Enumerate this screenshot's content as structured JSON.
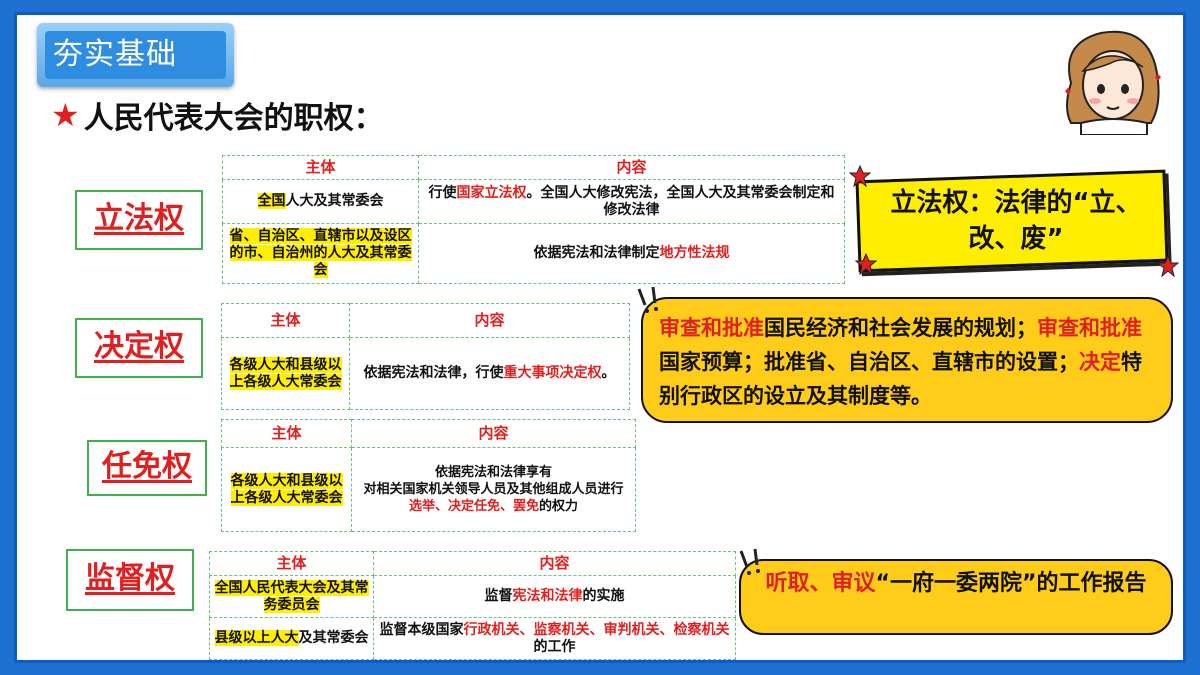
{
  "section_tag": "夯实基础",
  "headline": {
    "star": "★",
    "text": "人民代表大会的职权："
  },
  "colors": {
    "frame": "#0d5bc4",
    "accent_red": "#e0201f",
    "highlight": "#ffee00",
    "callout": "#ffcc1a",
    "border_green": "#3fb24f"
  },
  "powers": {
    "legislative": {
      "label": "立法权",
      "header_subject": "主体",
      "header_content": "内容",
      "rows": [
        {
          "subject_hl": "全国",
          "subject_rest": "人大及其常委会",
          "content_pre": "行使",
          "content_red": "国家立法权",
          "content_post": "。全国人大修改宪法，全国人大及其常委会制定和修改法律"
        },
        {
          "subject_hl": "省、自治区、直辖市以及设区的市、自治州的人大及其常委会",
          "subject_rest": "",
          "content_pre": "依据宪法和法律制定",
          "content_red": "地方性法规",
          "content_post": ""
        }
      ]
    },
    "decision": {
      "label": "决定权",
      "header_subject": "主体",
      "header_content": "内容",
      "subject": "各级人大和县级以上各级人大常委会",
      "content_pre": "依据宪法和法律，行使",
      "content_red": "重大事项决定权",
      "content_post": "。"
    },
    "appointment": {
      "label": "任免权",
      "header_subject": "主体",
      "header_content": "内容",
      "subject": "各级人大和县级以上各级人大常委会",
      "content_line1": "依据宪法和法律享有",
      "content_line2": "对相关国家机关领导人员及其他组成人员进行",
      "content_red": "选举、决定任免、罢免",
      "content_post": "的权力"
    },
    "supervision": {
      "label": "监督权",
      "header_subject": "主体",
      "header_content": "内容",
      "rows": [
        {
          "subject": "全国人民代表大会及其常务委员会",
          "content_pre": "监督",
          "content_red": "宪法和法律",
          "content_post": "的实施",
          "content_red2": "",
          "content_post2": ""
        },
        {
          "subject_hl": "县级以上人大",
          "subject_rest": "及其常委会",
          "content_pre": "监督本级国家",
          "content_red": "行政机关、监察机关、审判机关、检察机关",
          "content_post": "的工作"
        }
      ]
    }
  },
  "callouts": {
    "legislative": "立法权：法律的“立、改、废”",
    "decision": {
      "p1_red": "审查和批准",
      "p1": "国民经济和社会发展的规划；",
      "p2_red": "审查和批准",
      "p2": "国家预算；批准省、自治区、直辖市的设置；",
      "p3_red": "决定",
      "p3": "特别行政区的设立及其制度等。"
    },
    "supervision": {
      "red": "听取、审议",
      "rest": "“一府一委两院”的工作报告"
    }
  }
}
